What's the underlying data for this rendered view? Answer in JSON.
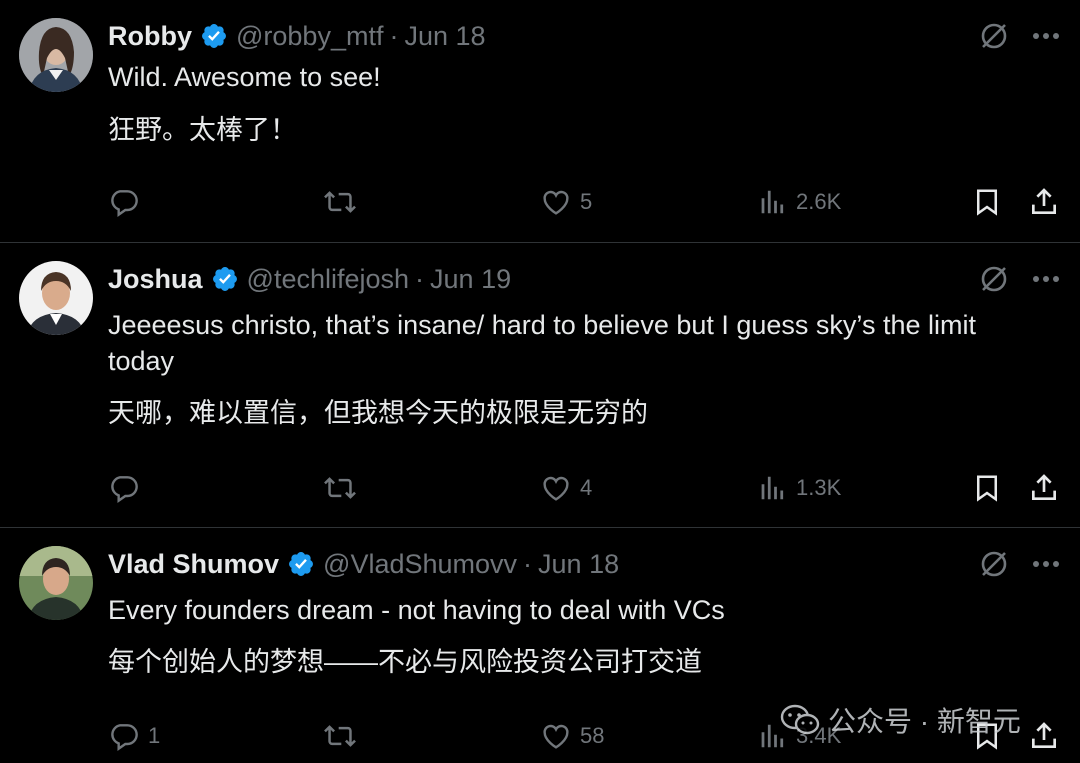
{
  "tweets": [
    {
      "name": "Robby",
      "handle": "@robby_mtf",
      "separator": "·",
      "date": "Jun 18",
      "text": "Wild. Awesome to see!",
      "translation": "狂野。太棒了！",
      "replies": "",
      "likes": "5",
      "views": "2.6K"
    },
    {
      "name": "Joshua",
      "handle": "@techlifejosh",
      "separator": "·",
      "date": "Jun 19",
      "text": "Jeeeesus christo, that’s insane/ hard to believe but I guess sky’s the limit today",
      "translation": "天哪，难以置信，但我想今天的极限是无穷的",
      "replies": "",
      "likes": "4",
      "views": "1.3K"
    },
    {
      "name": "Vlad Shumov",
      "handle": "@VladShumovv",
      "separator": "·",
      "date": "Jun 18",
      "text": "Every founders dream - not having to deal with VCs",
      "translation": "每个创始人的梦想——不必与风险投资公司打交道",
      "replies": "1",
      "likes": "58",
      "views": "3.4K"
    }
  ],
  "watermark": "公众号 · 新智元",
  "colors": {
    "background": "#000000",
    "primary_text": "#e7e9ea",
    "secondary_text": "#71767b",
    "verified_badge": "#1d9bf0",
    "divider": "#2f3336"
  },
  "icons": {
    "verified": "verified-badge-icon",
    "grok": "grok-icon",
    "more": "more-icon",
    "reply": "reply-icon",
    "retweet": "retweet-icon",
    "like": "heart-icon",
    "views": "views-chart-icon",
    "bookmark": "bookmark-icon",
    "share": "share-icon"
  }
}
